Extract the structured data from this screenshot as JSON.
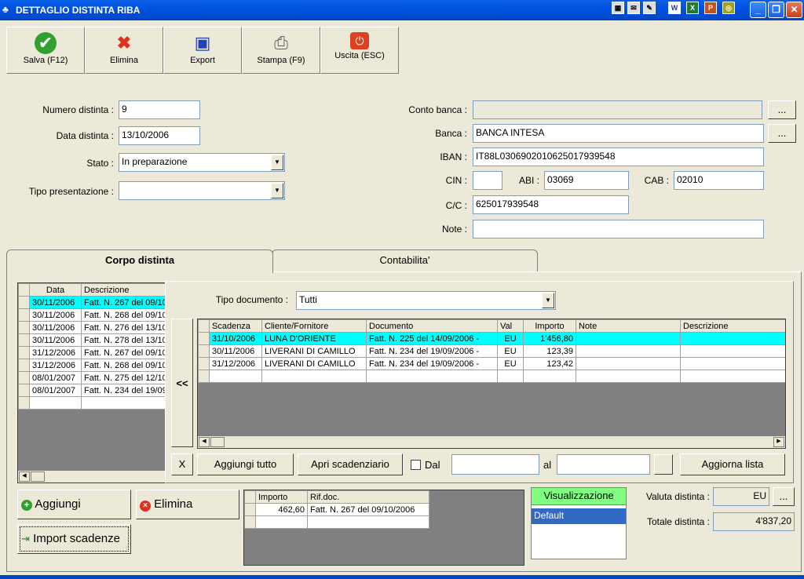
{
  "window": {
    "title": "DETTAGLIO DISTINTA RIBA"
  },
  "toolbar": [
    {
      "label": "Salva (F12)",
      "icon": "check-icon"
    },
    {
      "label": "Elimina",
      "icon": "x-icon"
    },
    {
      "label": "Export",
      "icon": "floppy-icon"
    },
    {
      "label": "Stampa (F9)",
      "icon": "printer-icon"
    },
    {
      "label": "Uscita (ESC)",
      "icon": "power-icon"
    }
  ],
  "form": {
    "numero_label": "Numero distinta :",
    "numero": "9",
    "data_label": "Data distinta :",
    "data": "13/10/2006",
    "stato_label": "Stato :",
    "stato": "In preparazione",
    "tipo_label": "Tipo presentazione :",
    "tipo": "",
    "conto_label": "Conto banca :",
    "conto": "",
    "banca_label": "Banca :",
    "banca": "BANCA INTESA",
    "iban_label": "IBAN :",
    "iban": "IT88L0306902010625017939548",
    "cin_label": "CIN :",
    "cin": "",
    "abi_label": "ABI :",
    "abi": "03069",
    "cab_label": "CAB :",
    "cab": "02010",
    "cc_label": "C/C :",
    "cc": "625017939548",
    "note_label": "Note :",
    "note": "",
    "browse": "..."
  },
  "tabs": [
    "Corpo distinta",
    "Contabilita'"
  ],
  "left_grid": {
    "headers": [
      "Data",
      "Descrizione"
    ],
    "rows": [
      [
        "30/11/2006",
        "Fatt. N. 267 del 09/10"
      ],
      [
        "30/11/2006",
        "Fatt. N. 268 del 09/10"
      ],
      [
        "30/11/2006",
        "Fatt. N. 276 del 13/10"
      ],
      [
        "30/11/2006",
        "Fatt. N. 278 del 13/10"
      ],
      [
        "31/12/2006",
        "Fatt. N. 267 del 09/10"
      ],
      [
        "31/12/2006",
        "Fatt. N. 268 del 09/10"
      ],
      [
        "08/01/2007",
        "Fatt. N. 275 del 12/10"
      ],
      [
        "08/01/2007",
        "Fatt. N. 234 del 19/09"
      ]
    ]
  },
  "popup": {
    "tipo_label": "Tipo documento :",
    "tipo": "Tutti",
    "back": "<<",
    "headers": [
      "Scadenza",
      "Cliente/Fornitore",
      "Documento",
      "Val",
      "Importo",
      "Note",
      "Descrizione"
    ],
    "rows": [
      [
        "31/10/2006",
        "LUNA D'ORIENTE",
        "Fatt. N. 225 del 14/09/2006 -",
        "EU",
        "1'456,80",
        "",
        ""
      ],
      [
        "30/11/2006",
        "LIVERANI DI CAMILLO",
        "Fatt. N. 234 del 19/09/2006 -",
        "EU",
        "123,39",
        "",
        ""
      ],
      [
        "31/12/2006",
        "LIVERANI DI CAMILLO",
        "Fatt. N. 234 del 19/09/2006 -",
        "EU",
        "123,42",
        "",
        ""
      ]
    ],
    "x": "X",
    "aggiungi_tutto": "Aggiungi tutto",
    "apri": "Apri scadenziario",
    "dal": "Dal",
    "al": "al",
    "aggiorna": "Aggiorna lista"
  },
  "bottom": {
    "aggiungi": "Aggiungi",
    "elimina": "Elimina",
    "import": "Import scadenze",
    "imp_headers": [
      "Importo",
      "Rif.doc."
    ],
    "imp_rows": [
      [
        "462,60",
        "Fatt. N. 267 del 09/10/2006"
      ]
    ],
    "visual_header": "Visualizzazione",
    "visual_item": "Default",
    "valuta_label": "Valuta distinta :",
    "valuta": "EU",
    "totale_label": "Totale distinta :",
    "totale": "4'837,20"
  }
}
